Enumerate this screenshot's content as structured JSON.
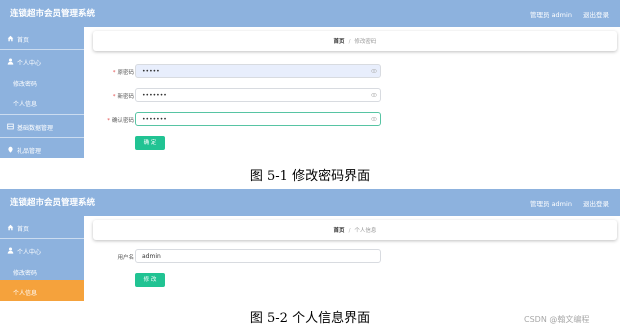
{
  "figure1": {
    "header": {
      "title": "连锁超市会员管理系统",
      "user": "管理员 admin",
      "logout": "退出登录"
    },
    "sidebar": {
      "home": "首页",
      "personal_center": "个人中心",
      "change_password": "修改密码",
      "personal_info": "个人信息",
      "basic_data": "基础数据管理",
      "gift": "礼品管理"
    },
    "breadcrumb": {
      "home": "首页",
      "separator": "/",
      "current": "修改密码"
    },
    "form": {
      "old_password": {
        "label": "原密码",
        "value": "•••••"
      },
      "new_password": {
        "label": "新密码",
        "value": "•••••••"
      },
      "confirm_password": {
        "label": "确认密码",
        "value": "•••••••"
      },
      "submit": "确 定"
    },
    "caption": "图 5-1 修改密码界面"
  },
  "figure2": {
    "header": {
      "title": "连锁超市会员管理系统",
      "user": "管理员 admin",
      "logout": "退出登录"
    },
    "sidebar": {
      "home": "首页",
      "personal_center": "个人中心",
      "change_password": "修改密码",
      "personal_info": "个人信息"
    },
    "breadcrumb": {
      "home": "首页",
      "separator": "/",
      "current": "个人信息"
    },
    "form": {
      "username": {
        "label": "用户名",
        "value": "admin"
      },
      "submit": "修 改"
    },
    "caption": "图 5-2 个人信息界面"
  },
  "watermark": "CSDN @翰文编程",
  "colors": {
    "header": "#8db2de",
    "active_nav": "#f5a23c",
    "button": "#21c393",
    "required": "#e24a4a"
  },
  "icons": {
    "home": "home-icon",
    "personal_center": "user-icon",
    "basic_data": "grid-icon",
    "gift": "gift-icon",
    "password_toggle": "eye-icon"
  }
}
